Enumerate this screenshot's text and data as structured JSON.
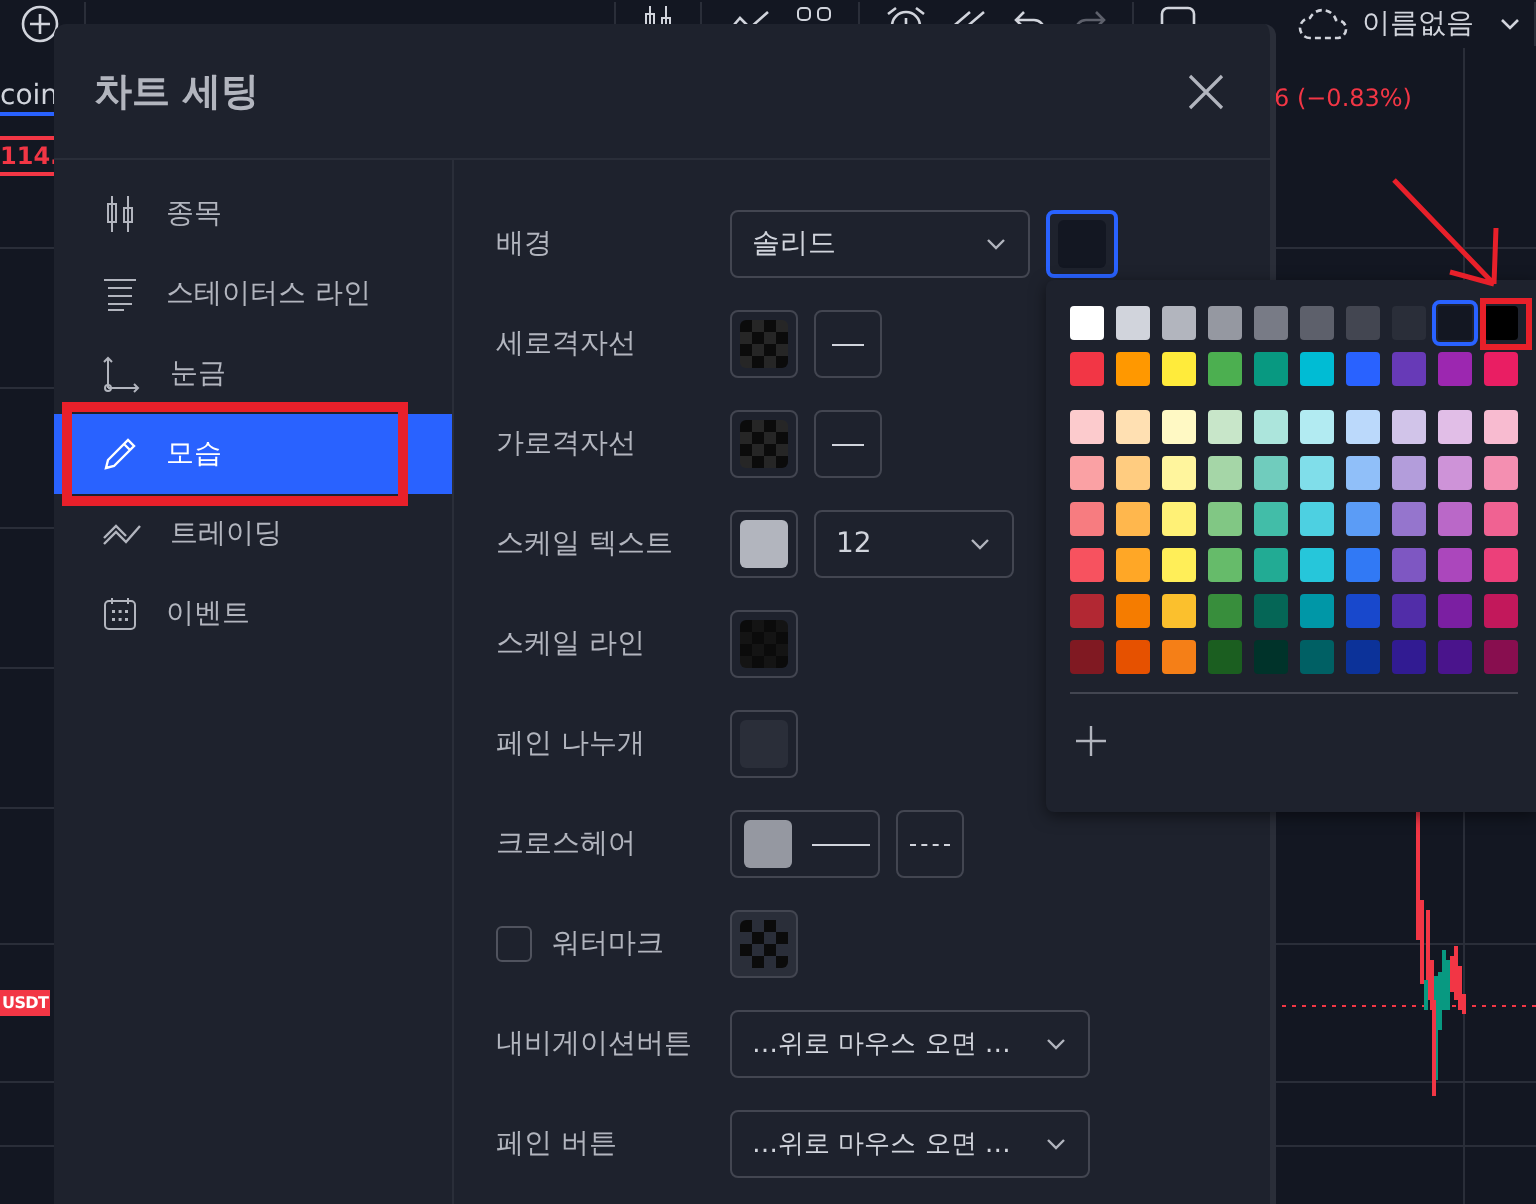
{
  "toolbar": {
    "layout_name": "이름없음"
  },
  "chart": {
    "symbol_label": "coin",
    "price_label": "114.",
    "currency_badge": "USDT",
    "change": "6 (−0.83%)"
  },
  "dialog": {
    "title": "차트 세팅",
    "tabs": [
      {
        "label": "종목",
        "selected": false
      },
      {
        "label": "스테이터스 라인",
        "selected": false
      },
      {
        "label": "눈금",
        "selected": false
      },
      {
        "label": "모습",
        "selected": true
      },
      {
        "label": "트레이딩",
        "selected": false
      },
      {
        "label": "이벤트",
        "selected": false
      }
    ],
    "rows": [
      {
        "label": "배경",
        "controls": [
          {
            "kind": "select",
            "value": "솔리드"
          },
          {
            "kind": "swatch",
            "color": "#131722",
            "open": true
          }
        ]
      },
      {
        "label": "세로격자선",
        "controls": [
          {
            "kind": "checker",
            "color": "#262626",
            "disabled": false
          },
          {
            "kind": "line"
          }
        ]
      },
      {
        "label": "가로격자선",
        "controls": [
          {
            "kind": "checker",
            "color": "#262626",
            "disabled": false
          },
          {
            "kind": "line"
          }
        ]
      },
      {
        "label": "스케일 텍스트",
        "controls": [
          {
            "kind": "swatch",
            "color": "#b2b5be",
            "open": false
          },
          {
            "kind": "select",
            "value": "12"
          }
        ]
      },
      {
        "label": "스케일 라인",
        "controls": [
          {
            "kind": "checker",
            "color": "#141414",
            "disabled": false
          }
        ]
      },
      {
        "label": "페인 나누개",
        "controls": [
          {
            "kind": "swatch",
            "color": "#2a2e39",
            "open": false
          }
        ]
      },
      {
        "label": "크로스헤어",
        "controls": [
          {
            "kind": "swatch_line",
            "color": "#9598a1",
            "open": false
          },
          {
            "kind": "dash"
          }
        ]
      },
      {
        "label": "워터마크",
        "checkbox": {
          "checked": false
        },
        "controls": [
          {
            "kind": "checker",
            "color": "#2a2e39",
            "disabled": true
          }
        ]
      },
      {
        "label": "내비게이션버튼",
        "controls": [
          {
            "kind": "select",
            "value": "…위로 마우스 오면 …"
          }
        ]
      },
      {
        "label": "페인 버튼",
        "controls": [
          {
            "kind": "select",
            "value": "…위로 마우스 오면 …"
          }
        ]
      }
    ]
  },
  "palette": {
    "rows": [
      [
        {
          "color": "#ffffff",
          "selected": false
        },
        {
          "color": "#d1d4dc",
          "selected": false
        },
        {
          "color": "#b2b5be",
          "selected": false
        },
        {
          "color": "#9598a1",
          "selected": false
        },
        {
          "color": "#787b86",
          "selected": false
        },
        {
          "color": "#5d606b",
          "selected": false
        },
        {
          "color": "#434651",
          "selected": false
        },
        {
          "color": "#2a2e39",
          "selected": false
        },
        {
          "color": "#131722",
          "selected": true
        },
        {
          "color": "#000000",
          "selected": false
        }
      ],
      [
        {
          "color": "#f23645",
          "selected": false
        },
        {
          "color": "#ff9800",
          "selected": false
        },
        {
          "color": "#ffeb3b",
          "selected": false
        },
        {
          "color": "#4caf50",
          "selected": false
        },
        {
          "color": "#089981",
          "selected": false
        },
        {
          "color": "#00bcd4",
          "selected": false
        },
        {
          "color": "#2962ff",
          "selected": false
        },
        {
          "color": "#673ab7",
          "selected": false
        },
        {
          "color": "#9c27b0",
          "selected": false
        },
        {
          "color": "#e91e63",
          "selected": false
        }
      ],
      [
        {
          "color": "#fccbcd",
          "selected": false
        },
        {
          "color": "#ffe0b2",
          "selected": false
        },
        {
          "color": "#fff9c4",
          "selected": false
        },
        {
          "color": "#c8e6c9",
          "selected": false
        },
        {
          "color": "#ace5dc",
          "selected": false
        },
        {
          "color": "#b2ebf2",
          "selected": false
        },
        {
          "color": "#bbd9fb",
          "selected": false
        },
        {
          "color": "#d1c4e9",
          "selected": false
        },
        {
          "color": "#e1bee7",
          "selected": false
        },
        {
          "color": "#f8bbd0",
          "selected": false
        }
      ],
      [
        {
          "color": "#faa1a4",
          "selected": false
        },
        {
          "color": "#ffcc80",
          "selected": false
        },
        {
          "color": "#fff59d",
          "selected": false
        },
        {
          "color": "#a5d6a7",
          "selected": false
        },
        {
          "color": "#70ccbd",
          "selected": false
        },
        {
          "color": "#80deea",
          "selected": false
        },
        {
          "color": "#90bff9",
          "selected": false
        },
        {
          "color": "#b39ddb",
          "selected": false
        },
        {
          "color": "#ce93d8",
          "selected": false
        },
        {
          "color": "#f48fb1",
          "selected": false
        }
      ],
      [
        {
          "color": "#f77c80",
          "selected": false
        },
        {
          "color": "#ffb74d",
          "selected": false
        },
        {
          "color": "#fff176",
          "selected": false
        },
        {
          "color": "#81c784",
          "selected": false
        },
        {
          "color": "#42bda8",
          "selected": false
        },
        {
          "color": "#4dd0e1",
          "selected": false
        },
        {
          "color": "#5b9cf6",
          "selected": false
        },
        {
          "color": "#9575cd",
          "selected": false
        },
        {
          "color": "#ba68c8",
          "selected": false
        },
        {
          "color": "#f06292",
          "selected": false
        }
      ],
      [
        {
          "color": "#f7525f",
          "selected": false
        },
        {
          "color": "#ffa726",
          "selected": false
        },
        {
          "color": "#ffee58",
          "selected": false
        },
        {
          "color": "#66bb6a",
          "selected": false
        },
        {
          "color": "#22ab94",
          "selected": false
        },
        {
          "color": "#26c6da",
          "selected": false
        },
        {
          "color": "#3179f5",
          "selected": false
        },
        {
          "color": "#7e57c2",
          "selected": false
        },
        {
          "color": "#ab47bc",
          "selected": false
        },
        {
          "color": "#ec407a",
          "selected": false
        }
      ],
      [
        {
          "color": "#b22833",
          "selected": false
        },
        {
          "color": "#f57c00",
          "selected": false
        },
        {
          "color": "#fbc02d",
          "selected": false
        },
        {
          "color": "#388e3c",
          "selected": false
        },
        {
          "color": "#056656",
          "selected": false
        },
        {
          "color": "#0097a7",
          "selected": false
        },
        {
          "color": "#1848cc",
          "selected": false
        },
        {
          "color": "#512da8",
          "selected": false
        },
        {
          "color": "#7b1fa2",
          "selected": false
        },
        {
          "color": "#c2185b",
          "selected": false
        }
      ],
      [
        {
          "color": "#801922",
          "selected": false
        },
        {
          "color": "#e65100",
          "selected": false
        },
        {
          "color": "#f57f17",
          "selected": false
        },
        {
          "color": "#1b5e20",
          "selected": false
        },
        {
          "color": "#00332a",
          "selected": false
        },
        {
          "color": "#006064",
          "selected": false
        },
        {
          "color": "#0c3299",
          "selected": false
        },
        {
          "color": "#311b92",
          "selected": false
        },
        {
          "color": "#4a148c",
          "selected": false
        },
        {
          "color": "#880e4f",
          "selected": false
        }
      ]
    ]
  }
}
